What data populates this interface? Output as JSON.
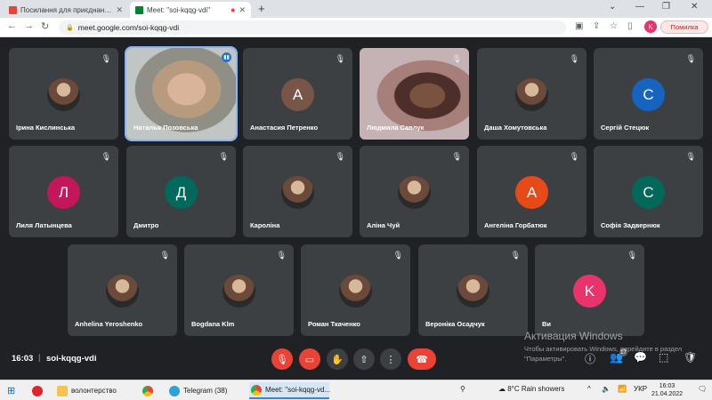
{
  "browser": {
    "tabs": [
      {
        "label": "Посилання для приєднання до ...",
        "favicon_color": "#ea4335"
      },
      {
        "label": "Meet: \"soi-kqqg-vdi\"",
        "favicon_color": "#00832d"
      }
    ],
    "url": "meet.google.com/soi-kqqg-vdi",
    "profile_initial": "K",
    "error_label": "Помилка"
  },
  "participants": [
    {
      "name": "Ірина Кислинська",
      "type": "photo"
    },
    {
      "name": "Наталья Позовська",
      "type": "video",
      "speaking": true
    },
    {
      "name": "Анастасия Петренко",
      "type": "initial",
      "initial": "А",
      "color": "#795548"
    },
    {
      "name": "Людмила Савлук",
      "type": "video"
    },
    {
      "name": "Даша Хомутовська",
      "type": "photo"
    },
    {
      "name": "Сергій Стецюк",
      "type": "initial",
      "initial": "С",
      "color": "#1565c0"
    },
    {
      "name": "Лиля Латынцева",
      "type": "initial",
      "initial": "Л",
      "color": "#c2185b"
    },
    {
      "name": "Дмитро",
      "type": "initial",
      "initial": "Д",
      "color": "#00695c"
    },
    {
      "name": "Кароліна",
      "type": "photo"
    },
    {
      "name": "Аліна Чуй",
      "type": "photo"
    },
    {
      "name": "Ангеліна Горбатюк",
      "type": "initial",
      "initial": "А",
      "color": "#e64a19"
    },
    {
      "name": "Софія Задвернюк",
      "type": "initial",
      "initial": "С",
      "color": "#00695c"
    },
    {
      "name": "Anhelina Yeroshenko",
      "type": "photo"
    },
    {
      "name": "Bogdana Klm",
      "type": "photo"
    },
    {
      "name": "Роман Ткаченко",
      "type": "photo"
    },
    {
      "name": "Вероніка Осадчук",
      "type": "photo"
    },
    {
      "name": "Ви",
      "type": "initial",
      "initial": "K",
      "color": "#e8336d"
    }
  ],
  "meeting": {
    "time": "16:03",
    "code": "soi-kqqg-vdi",
    "participants_count": "17"
  },
  "windows_activation": {
    "title": "Активация Windows",
    "text": "Чтобы активировать Windows, перейдите в раздел \"Параметры\"."
  },
  "taskbar": {
    "folder_label": "волонтерство",
    "telegram_label": "Telegram (38)",
    "meet_label": "Meet: \"soi-kqqg-vd...",
    "weather": "8°C  Rain showers",
    "lang": "УКР",
    "time": "16:03",
    "date": "21.04.2022"
  }
}
